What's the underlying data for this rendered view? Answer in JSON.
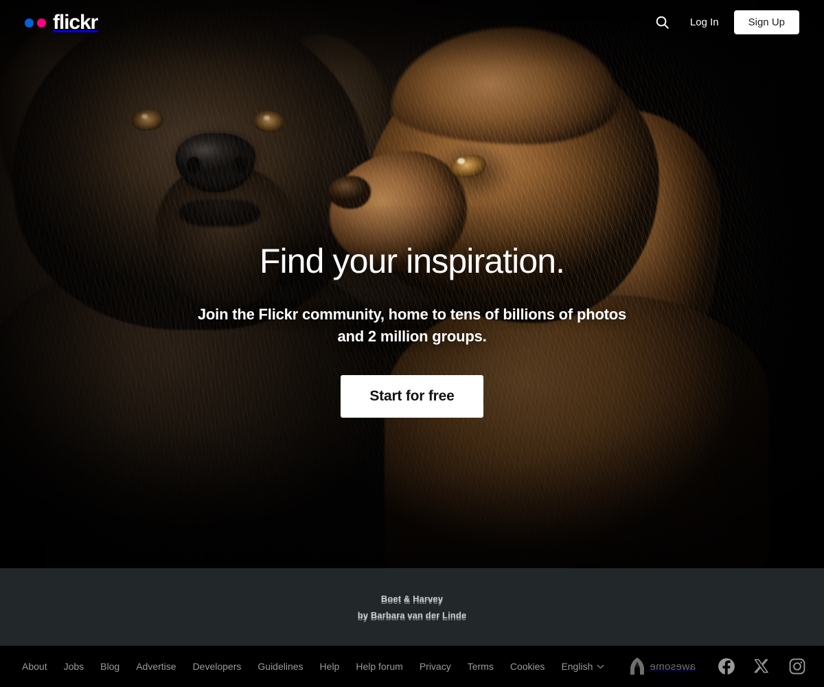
{
  "brand": {
    "name": "flickr",
    "dot_blue": "#0063DC",
    "dot_pink": "#FF0084"
  },
  "header": {
    "search_icon": "search-icon",
    "login_label": "Log In",
    "signup_label": "Sign Up"
  },
  "hero": {
    "title": "Find your inspiration.",
    "subtitle": "Join the Flickr community, home to tens of billions of photos and 2 million groups.",
    "cta_label": "Start for free"
  },
  "credit": {
    "photo_title": "Boet & Harvey",
    "photographer": "by Barbara van der Linde",
    "band_color": "#222729"
  },
  "footer": {
    "links": [
      {
        "label": "About"
      },
      {
        "label": "Jobs"
      },
      {
        "label": "Blog"
      },
      {
        "label": "Advertise"
      },
      {
        "label": "Developers"
      },
      {
        "label": "Guidelines"
      },
      {
        "label": "Help"
      },
      {
        "label": "Help forum"
      },
      {
        "label": "Privacy"
      },
      {
        "label": "Terms"
      },
      {
        "label": "Cookies"
      }
    ],
    "language": {
      "label": "English",
      "chevron_icon": "chevron-down-icon"
    },
    "partner": {
      "label": "awesome",
      "icon": "smugmug-awesome-icon"
    },
    "social": [
      {
        "name": "facebook-icon"
      },
      {
        "name": "x-twitter-icon"
      },
      {
        "name": "instagram-icon"
      }
    ]
  }
}
